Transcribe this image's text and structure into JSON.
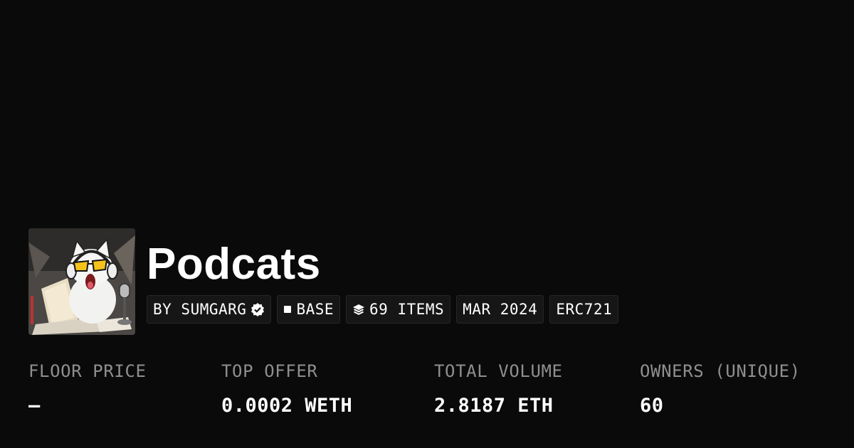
{
  "collection": {
    "name": "Podcats",
    "image_alt": "cartoon cat with headphones at a laptop and microphone"
  },
  "chips": {
    "creator": "BY SUMGARG",
    "chain": "BASE",
    "items": "69 ITEMS",
    "date": "MAR 2024",
    "standard": "ERC721"
  },
  "stats": [
    {
      "label": "FLOOR PRICE",
      "value": "–"
    },
    {
      "label": "TOP OFFER",
      "value": "0.0002 WETH"
    },
    {
      "label": "TOTAL VOLUME",
      "value": "2.8187 ETH"
    },
    {
      "label": "OWNERS (UNIQUE)",
      "value": "60"
    }
  ],
  "icons": {
    "verified": "verified-badge-icon",
    "chain": "base-chain-icon",
    "items": "layers-icon"
  },
  "colors": {
    "background": "#0a0a0a",
    "chip_background": "#161616",
    "label": "#8f8f8f",
    "text": "#ffffff"
  }
}
